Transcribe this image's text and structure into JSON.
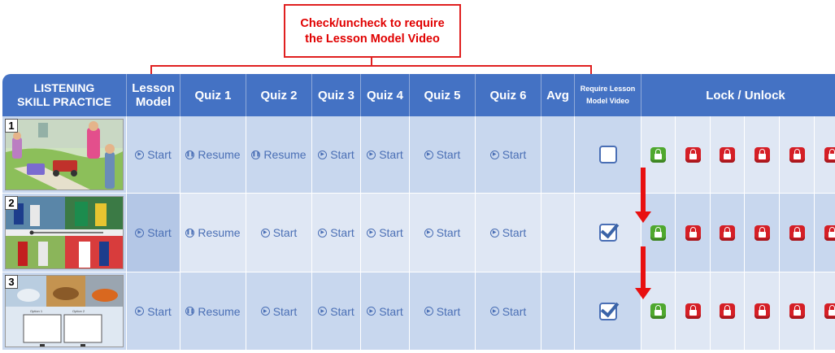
{
  "callout": {
    "line1": "Check/uncheck to require",
    "line2": "the Lesson Model Video"
  },
  "header": {
    "skill_line1": "LISTENING",
    "skill_line2": "SKILL PRACTICE",
    "lesson_line1": "Lesson",
    "lesson_line2": "Model",
    "quiz1": "Quiz 1",
    "quiz2": "Quiz 2",
    "quiz3": "Quiz 3",
    "quiz4": "Quiz 4",
    "quiz5": "Quiz 5",
    "quiz6": "Quiz 6",
    "avg": "Avg",
    "req_line1": "Require Lesson",
    "req_line2": "Model Video",
    "lock": "Lock / Unlock"
  },
  "rows": [
    {
      "num": "1",
      "lesson": "Start",
      "quiz1": "Resume",
      "quiz2": "Resume",
      "quiz3": "Start",
      "quiz4": "Start",
      "quiz5": "Start",
      "quiz6": "Start",
      "require": false,
      "locks": [
        "unlocked",
        "locked",
        "locked",
        "locked",
        "locked",
        "locked"
      ]
    },
    {
      "num": "2",
      "lesson": "Start",
      "quiz1": "Resume",
      "quiz2": "Start",
      "quiz3": "Start",
      "quiz4": "Start",
      "quiz5": "Start",
      "quiz6": "Start",
      "require": true,
      "locks": [
        "unlocked",
        "locked",
        "locked",
        "locked",
        "locked",
        "locked"
      ]
    },
    {
      "num": "3",
      "lesson": "Start",
      "quiz1": "Resume",
      "quiz2": "Start",
      "quiz3": "Start",
      "quiz4": "Start",
      "quiz5": "Start",
      "quiz6": "Start",
      "require": true,
      "locks": [
        "unlocked",
        "locked",
        "locked",
        "locked",
        "locked",
        "locked"
      ],
      "option1": "Option 1",
      "option2": "Option 2"
    }
  ],
  "colors": {
    "header": "#4472c4",
    "accent": "#4a6fb5",
    "lock_red": "#d51f26",
    "lock_green": "#4fa82e",
    "callout": "#e00000"
  },
  "icons": {
    "start": "play-circle-icon",
    "resume": "pause-circle-icon",
    "locked": "padlock-red-icon",
    "unlocked": "padlock-green-icon"
  }
}
